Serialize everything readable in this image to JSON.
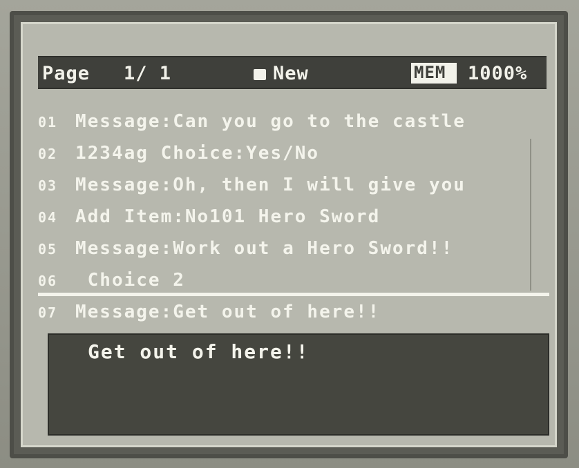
{
  "header": {
    "page_label": "Page",
    "page_number": "1/ 1",
    "new_label": "New",
    "mem_label": "MEM",
    "mem_value": "1000%"
  },
  "events": [
    {
      "num": "01",
      "text": "Message:Can you go to the castle"
    },
    {
      "num": "02",
      "text": "1234ag Choice:Yes/No"
    },
    {
      "num": "03",
      "text": "Message:Oh, then I will give you"
    },
    {
      "num": "04",
      "text": "Add Item:No101 Hero Sword"
    },
    {
      "num": "05",
      "text": "Message:Work out a Hero Sword!!"
    },
    {
      "num": "06",
      "text": "    Choice 2"
    },
    {
      "num": "07",
      "text": "Message:Get out of here!!"
    }
  ],
  "selected_event": 5,
  "message_window": {
    "text": "Get out of here!!"
  }
}
